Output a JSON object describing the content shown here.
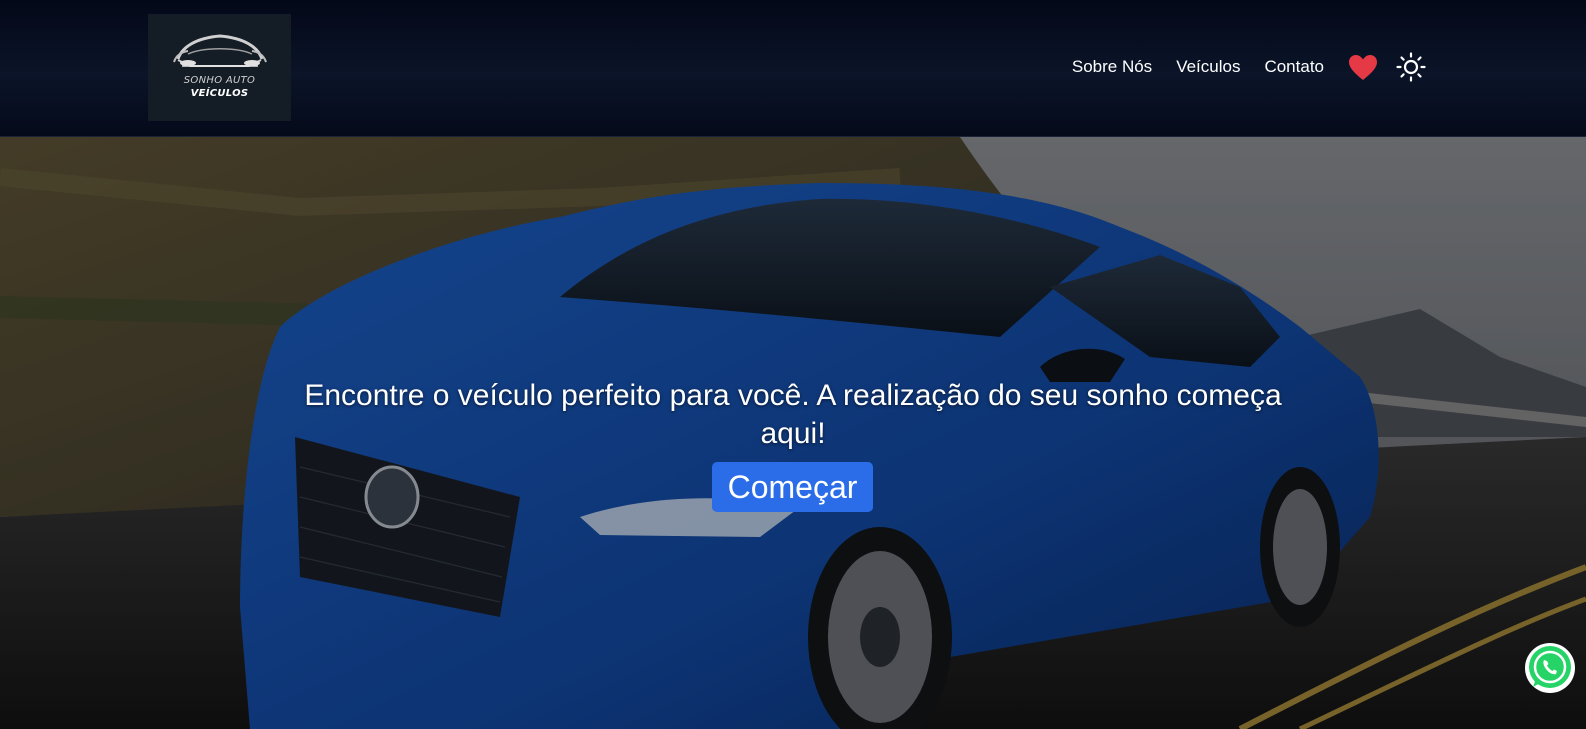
{
  "brand": {
    "logo_line1": "SONHO AUTO",
    "logo_line2": "VEÍCULOS"
  },
  "nav": {
    "items": [
      {
        "label": "Sobre Nós"
      },
      {
        "label": "Veículos"
      },
      {
        "label": "Contato"
      }
    ],
    "favorites_icon": "heart-icon",
    "theme_toggle_icon": "sun-icon"
  },
  "hero": {
    "headline": "Encontre o veículo perfeito para você. A realização do seu sonho começa aqui!",
    "cta_label": "Começar"
  },
  "floating": {
    "chat_icon": "whatsapp-icon"
  },
  "colors": {
    "header_bg": "#030818",
    "cta_bg": "#2b6de8",
    "heart": "#e53945",
    "whatsapp": "#25d366",
    "car_body": "#1553b5"
  }
}
